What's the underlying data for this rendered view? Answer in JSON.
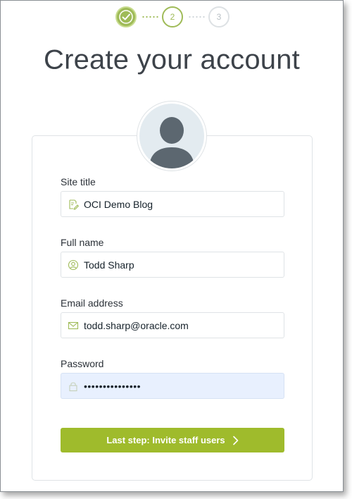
{
  "steps": [
    {
      "state": "done",
      "label": ""
    },
    {
      "state": "active",
      "label": "2"
    },
    {
      "state": "todo",
      "label": "3"
    }
  ],
  "title": "Create your account",
  "form": {
    "site_title": {
      "label": "Site title",
      "value": "OCI Demo Blog",
      "icon": "edit-document-icon"
    },
    "full_name": {
      "label": "Full name",
      "value": "Todd Sharp",
      "icon": "user-circle-icon"
    },
    "email": {
      "label": "Email address",
      "value": "todd.sharp@oracle.com",
      "icon": "envelope-icon"
    },
    "password": {
      "label": "Password",
      "value": "•••••••••••••••",
      "icon": "lock-icon"
    }
  },
  "submit_label": "Last step: Invite staff users",
  "colors": {
    "accent": "#9fbb2c",
    "text": "#15212a",
    "border": "#dfe3e6"
  }
}
